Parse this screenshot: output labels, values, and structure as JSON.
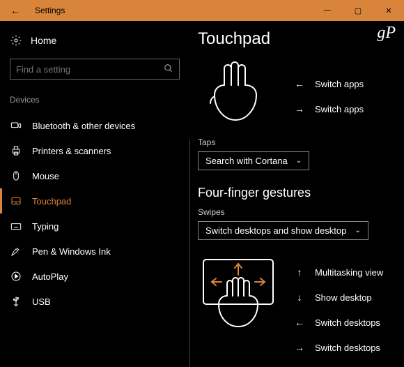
{
  "titlebar": {
    "title": "Settings"
  },
  "watermark": "gP",
  "sidebar": {
    "home": "Home",
    "search_placeholder": "Find a setting",
    "section": "Devices",
    "items": [
      {
        "label": "Bluetooth & other devices"
      },
      {
        "label": "Printers & scanners"
      },
      {
        "label": "Mouse"
      },
      {
        "label": "Touchpad"
      },
      {
        "label": "Typing"
      },
      {
        "label": "Pen & Windows Ink"
      },
      {
        "label": "AutoPlay"
      },
      {
        "label": "USB"
      }
    ]
  },
  "main": {
    "title": "Touchpad",
    "swipe_left_top": "Switch apps",
    "swipe_right_top": "Switch apps",
    "taps_label": "Taps",
    "taps_value": "Search with Cortana",
    "four_heading": "Four-finger gestures",
    "swipes_label": "Swipes",
    "swipes_value": "Switch desktops and show desktop",
    "gesture_up": "Multitasking view",
    "gesture_down": "Show desktop",
    "gesture_left": "Switch desktops",
    "gesture_right": "Switch desktops"
  },
  "colors": {
    "accent": "#d8843a"
  }
}
